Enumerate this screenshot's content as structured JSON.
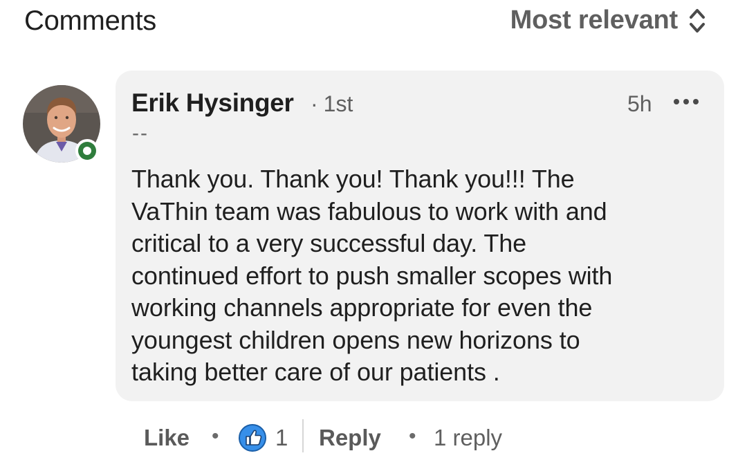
{
  "header": {
    "title": "Comments",
    "sort_label": "Most relevant"
  },
  "comment": {
    "author": "Erik Hysinger",
    "degree": "1st",
    "time": "5h",
    "headline": "--",
    "body": "Thank you. Thank you! Thank you!!! The\nVaThin team was fabulous to work with and\ncritical to a very successful day.  The\ncontinued effort to push smaller scopes with\nworking channels appropriate for even the\nyoungest children opens new horizons to\ntaking better care of our patients .",
    "online": true
  },
  "actions": {
    "like_label": "Like",
    "reaction_count": "1",
    "reply_label": "Reply",
    "replies_label": "1 reply"
  },
  "icons": {
    "sort": "up-down-chevron-icon",
    "more": "ellipsis-icon",
    "reaction": "thumbs-up-icon",
    "presence": "online-status-icon"
  },
  "colors": {
    "bubble": "#f2f2f2",
    "online_green": "#2f7d3c",
    "like_blue": "#378fe9",
    "muted_text": "#5f5f5f"
  }
}
